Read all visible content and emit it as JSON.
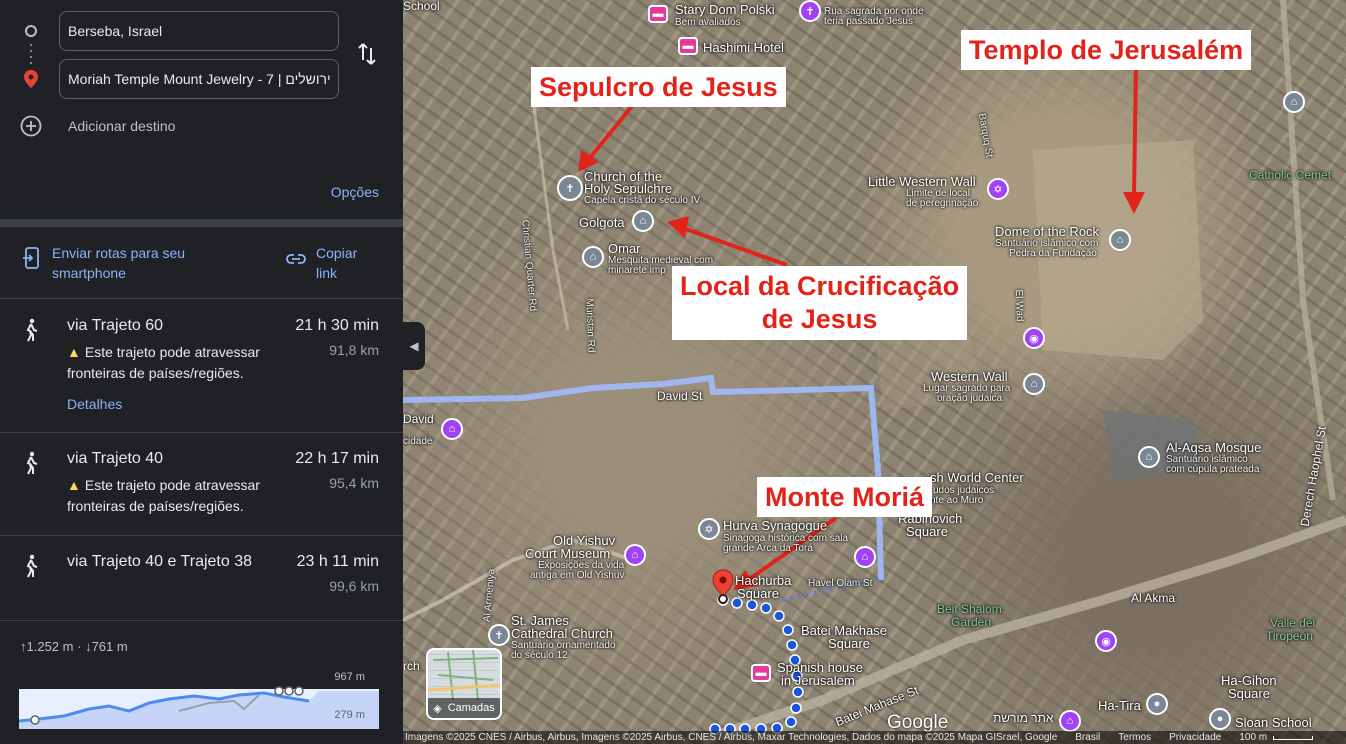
{
  "directions": {
    "origin": "Berseba, Israel",
    "destination": "Moriah Temple Mount Jewelry - 7 | ירושלים",
    "add_destination": "Adicionar destino",
    "options": "Opções",
    "send_to_phone": "Enviar rotas para seu smartphone",
    "copy_link": "Copiar link"
  },
  "routes": [
    {
      "name": "via Trajeto 60",
      "time": "21 h 30 min",
      "distance": "91,8 km",
      "warning": "Este trajeto pode atravessar fronteiras de países/regiões.",
      "details": "Detalhes"
    },
    {
      "name": "via Trajeto 40",
      "time": "22 h 17 min",
      "distance": "95,4 km",
      "warning": "Este trajeto pode atravessar fronteiras de países/regiões."
    },
    {
      "name": "via Trajeto 40 e Trajeto 38",
      "time": "23 h 11 min",
      "distance": "99,6 km"
    }
  ],
  "elevation": {
    "up": "↑1.252 m",
    "dot": "·",
    "down": "↓761 m",
    "max": "967 m",
    "min": "279 m"
  },
  "callouts": {
    "sepulcro": "Sepulcro de Jesus",
    "templo": "Templo de Jerusalém",
    "crucificacao_1": "Local da Crucificação",
    "crucificacao_2": "de Jesus",
    "moria": "Monte Moriá"
  },
  "map_labels": {
    "school": "School",
    "stary_dom": "Stary Dom Polski",
    "stary_dom_sub": "Bem avaliados",
    "hashimi": "Hashimi Hotel",
    "rua_sagrada_1": "Rua sagrada por onde",
    "rua_sagrada_2": "teria passado Jesus",
    "holy_sepulchre_1": "Church of the",
    "holy_sepulchre_2": "Holy Sepulchre",
    "holy_sepulchre_sub": "Capela cristã do século IV",
    "golgota": "Golgota",
    "omar": "Omar",
    "omar_sub_1": "Mesquita medieval com",
    "omar_sub_2": "minarete imp",
    "little_wall": "Little Western Wall",
    "little_wall_sub_1": "Limite de local",
    "little_wall_sub_2": "de peregrinação",
    "dome": "Dome of the Rock",
    "dome_sub_1": "Santuário islâmico com",
    "dome_sub_2": "Pedra da Fundação",
    "catholic": "Catholic Cemet",
    "western_wall": "Western Wall",
    "western_wall_sub_1": "Lugar sagrado para",
    "western_wall_sub_2": "oração judaica",
    "david_st": "David St",
    "david": "David",
    "david_sub": "cidade",
    "al_aqsa": "Al-Aqsa Mosque",
    "al_aqsa_sub_1": "Santuário islâmico",
    "al_aqsa_sub_2": "com cúpula prateada",
    "world_center": "sh World Center",
    "world_center_sub_1": "udos judaicos",
    "world_center_sub_2": "nte ao Muro",
    "rabinovich": "Rabinovich",
    "square": "Square",
    "hurva": "Hurva Synagogue",
    "hurva_sub_1": "Sinagoga histórica com sala",
    "hurva_sub_2": "grande Arca da Torá",
    "old_yishuv_1": "Old Yishuv",
    "old_yishuv_2": "Court Museum",
    "old_yishuv_sub_1": "Exposições da vida",
    "old_yishuv_sub_2": "antiga em Old Yishuv",
    "hurba_1": "Hachurba",
    "hurba_2": "Square",
    "havel_olam": "Havel Olam St",
    "st_james_1": "St. James",
    "st_james_2": "Cathedral Church",
    "st_james_sub_1": "Santuário ornamentado",
    "st_james_sub_2": "do século 12",
    "batei_1": "Batei Makhase",
    "batei_2": "Square",
    "spanish_1": "Spanish house",
    "spanish_2": "in Jerusalem",
    "batei_st": "Batei Mahase St",
    "beit_shalom_1": "Beit Shalom",
    "beit_shalom_2": "Garden",
    "al_akma": "Al Akma",
    "valle_1": "Valle del",
    "valle_2": "Tiropeón",
    "ha_gihon_1": "Ha-Gihon",
    "ha_gihon_2": "Square",
    "ha_tira": "Ha-Tira",
    "sloan": "Sloan School",
    "derech": "Derech Haophel St",
    "christian_q": "Christian Quarter Rd",
    "muristan": "Muristan Rd",
    "el_wad": "El Wad",
    "al_armeni": "Al Armeniya",
    "barquq": "Barquq St",
    "ch": "rch",
    "hebrew": "אתר מורשת"
  },
  "map_ui": {
    "layers": "Camadas",
    "google": "Google",
    "attribution": "Imagens ©2025 CNES / Airbus, Airbus, Imagens ©2025 Airbus, CNES / Airbus, Maxar Technologies, Dados do mapa ©2025 Mapa GISrael, Google",
    "country": "Brasil",
    "terms": "Termos",
    "privacy": "Privacidade",
    "scale": "100 m"
  },
  "colors": {
    "panel_bg": "#202124",
    "link": "#8ab4f8",
    "callout_text": "#e2231a",
    "route_walk": "#1a56db",
    "route_alt": "#9fb8f5"
  },
  "icons": [
    "walk-icon",
    "warning-icon",
    "swap-icon",
    "add-icon",
    "phone-icon",
    "link-icon",
    "pin-icon",
    "layers-icon"
  ]
}
